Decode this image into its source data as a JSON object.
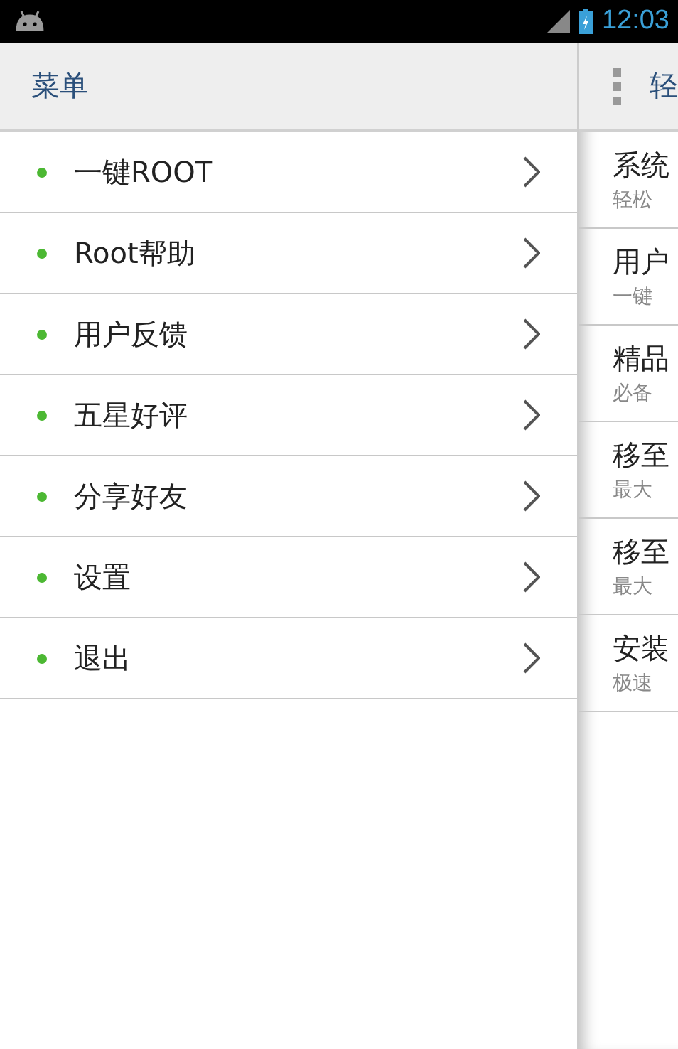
{
  "status_bar": {
    "time": "12:03"
  },
  "menu": {
    "title": "菜单",
    "items": [
      {
        "label": "一键ROOT"
      },
      {
        "label": "Root帮助"
      },
      {
        "label": "用户反馈"
      },
      {
        "label": "五星好评"
      },
      {
        "label": "分享好友"
      },
      {
        "label": "设置"
      },
      {
        "label": "退出"
      }
    ]
  },
  "main": {
    "title": "轻",
    "items": [
      {
        "title": "系统",
        "subtitle": "轻松"
      },
      {
        "title": "用户",
        "subtitle": "一键"
      },
      {
        "title": "精品",
        "subtitle": "必备"
      },
      {
        "title": "移至",
        "subtitle": "最大"
      },
      {
        "title": "移至",
        "subtitle": "最大"
      },
      {
        "title": "安装",
        "subtitle": "极速"
      }
    ]
  }
}
